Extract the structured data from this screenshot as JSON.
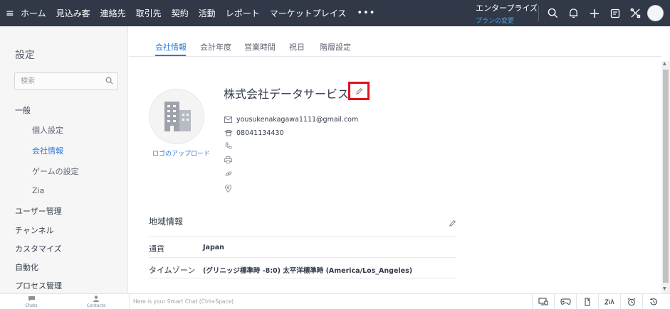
{
  "topbar": {
    "menu_icon": "hamburger-icon",
    "nav": [
      "ホーム",
      "見込み客",
      "連絡先",
      "取引先",
      "契約",
      "活動",
      "レポート",
      "マーケットプレイス"
    ],
    "more": "•••",
    "edition": "エンタープライズ",
    "edition_link": "プランの変更",
    "icons": [
      "search-icon",
      "bell-icon",
      "plus-icon",
      "calendar-icon",
      "tools-icon"
    ]
  },
  "sidebar": {
    "title": "設定",
    "search_placeholder": "検索",
    "general": "一般",
    "items": {
      "personal": "個人設定",
      "company": "会社情報",
      "game": "ゲームの設定",
      "zia": "Zia"
    },
    "sections": {
      "users": "ユーザー管理",
      "channels": "チャンネル",
      "customize": "カスタマイズ",
      "automation": "自動化",
      "process": "プロセス管理"
    }
  },
  "tabs": [
    "会社情報",
    "会計年度",
    "営業時間",
    "祝日",
    "階層設定"
  ],
  "company": {
    "logo_upload": "ロゴのアップロード",
    "name": "株式会社データサービス",
    "email": "yousukenakagawa1111@gmail.com",
    "phone": "08041134430"
  },
  "region": {
    "title": "地域情報",
    "currency_label": "通貨",
    "currency_value": "Japan",
    "timezone_label": "タイムゾーン",
    "timezone_value": "(グリニッジ標準時 -8:0) 太平洋標準時 (America/Los_Angeles)"
  },
  "bottombar": {
    "chats": "Chats",
    "contacts": "Contacts",
    "smartchat_placeholder": "Here is your Smart Chat (Ctrl+Space)"
  },
  "colors": {
    "topbar": "#313949",
    "accent": "#2b7ad6",
    "highlight": "#e0131c"
  }
}
